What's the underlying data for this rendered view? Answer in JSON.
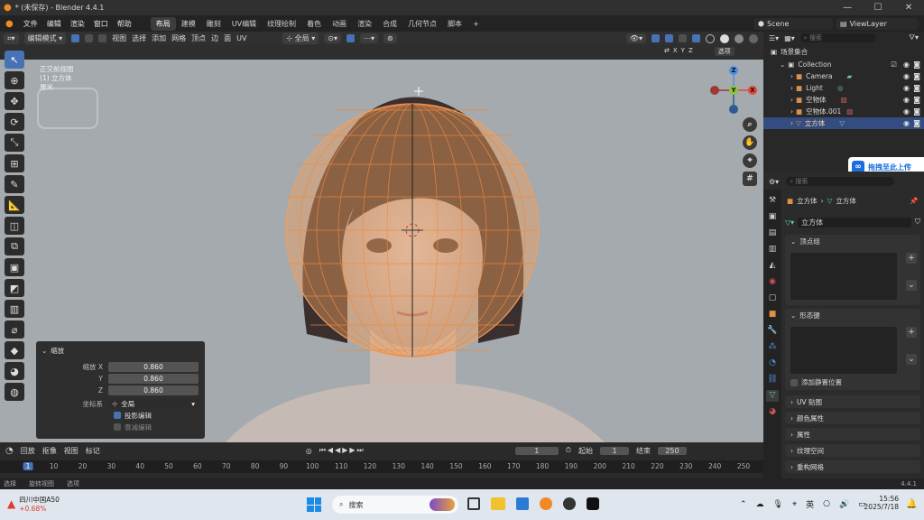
{
  "window": {
    "title": "* (未保存) - Blender 4.4.1"
  },
  "menu": {
    "items": [
      "文件",
      "编辑",
      "渲染",
      "窗口",
      "帮助"
    ],
    "workspaces": [
      "布局",
      "建模",
      "雕刻",
      "UV编辑",
      "纹理绘制",
      "着色",
      "动画",
      "渲染",
      "合成",
      "几何节点",
      "脚本"
    ],
    "active_workspace": "布局",
    "add_tab": "+",
    "scene": "Scene",
    "view_layer": "ViewLayer"
  },
  "viewport_header": {
    "mode": "编辑模式",
    "menus": [
      "视图",
      "选择",
      "添加",
      "网格",
      "顶点",
      "边",
      "面",
      "UV"
    ],
    "transform_orientation": "全局",
    "options_label": "选项",
    "axes": [
      "X",
      "Y",
      "Z"
    ]
  },
  "hud": {
    "view": "正交前视图",
    "object": "(1) 立方体",
    "units": "厘米"
  },
  "operator_panel": {
    "title": "缩放",
    "fields": [
      {
        "label": "缩放 X",
        "value": "0.860"
      },
      {
        "label": "Y",
        "value": "0.860"
      },
      {
        "label": "Z",
        "value": "0.860"
      }
    ],
    "orientation_label": "坐标系",
    "orientation_value": "全局",
    "checkbox_1": "投影编辑",
    "checkbox_2": "衰减编辑"
  },
  "gizmo": {
    "z": "Z",
    "x": "X",
    "y": "Y"
  },
  "timeline": {
    "menus": [
      "回放",
      "抠像",
      "视图",
      "标记"
    ],
    "current_frame": "1",
    "start_label": "起始",
    "start": "1",
    "end_label": "结束",
    "end": "250",
    "ruler": [
      "1",
      "10",
      "20",
      "30",
      "40",
      "50",
      "60",
      "70",
      "80",
      "90",
      "100",
      "110",
      "120",
      "130",
      "140",
      "150",
      "160",
      "170",
      "180",
      "190",
      "200",
      "210",
      "220",
      "230",
      "240",
      "250"
    ]
  },
  "statusbar": {
    "items": [
      "选择",
      "旋转视图",
      "选项"
    ],
    "version": "4.4.1"
  },
  "outliner": {
    "search_placeholder": "搜索",
    "rows": [
      {
        "label": "场景集合"
      },
      {
        "label": "Collection"
      },
      {
        "label": "Camera"
      },
      {
        "label": "Light"
      },
      {
        "label": "空物体"
      },
      {
        "label": "空物体.001"
      },
      {
        "label": "立方体"
      }
    ]
  },
  "upload_widget": {
    "label": "拖拽至此上传"
  },
  "properties": {
    "search_placeholder": "搜索",
    "breadcrumb_object": "立方体",
    "breadcrumb_mesh": "立方体",
    "mesh_name": "立方体",
    "panels": {
      "vertex_groups": "顶点组",
      "shape_keys": "形态键",
      "add_rest_position": "添加静置位置",
      "uv_maps": "UV 贴图",
      "color_attributes": "颜色属性",
      "attributes": "属性",
      "texture_space": "纹理空间",
      "remesh": "重构网格"
    }
  },
  "taskbar": {
    "stock_name": "四川中国A50",
    "stock_change": "+0.68%",
    "search": "搜索",
    "ime": "英",
    "time": "15:56",
    "date": "2025/7/18"
  },
  "colors": {
    "accent": "#4772b3",
    "mesh": "#f0a060",
    "x_axis": "#e4473c",
    "y_axis": "#8ac43a",
    "z_axis": "#4c8fe2"
  }
}
